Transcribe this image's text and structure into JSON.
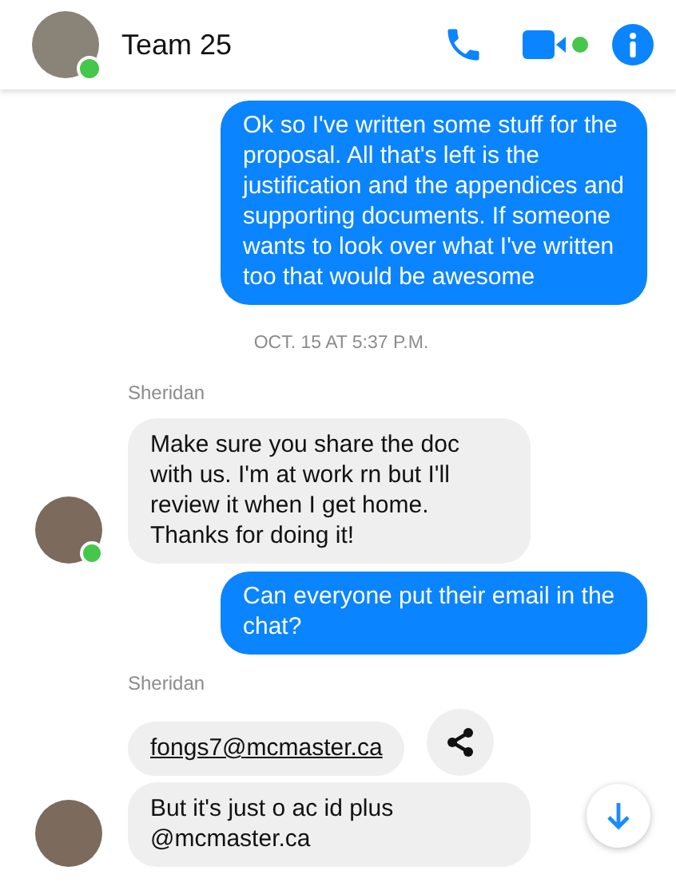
{
  "header": {
    "title": "Team 25",
    "online": true
  },
  "messages": [
    {
      "kind": "outgoing",
      "text": "Ok so I've written some stuff for the proposal. All that's left is the justification and the appendices and supporting documents. If someone wants to look over what I've written too that would be awesome"
    },
    {
      "kind": "timestamp",
      "text": "OCT. 15 AT 5:37 P.M."
    },
    {
      "kind": "sender",
      "text": "Sheridan"
    },
    {
      "kind": "incoming",
      "text": "Make sure you share the doc with us. I'm at work rn but I'll review it when I get home. Thanks for doing it!",
      "avatar": true,
      "online": true
    },
    {
      "kind": "outgoing",
      "text": "Can everyone put their email in the chat?"
    },
    {
      "kind": "sender",
      "text": "Sheridan"
    },
    {
      "kind": "link",
      "text": "fongs7@mcmaster.ca"
    },
    {
      "kind": "incoming",
      "text": "But it's just o ac id plus @mcmaster.ca",
      "avatar": true,
      "online": false
    }
  ]
}
